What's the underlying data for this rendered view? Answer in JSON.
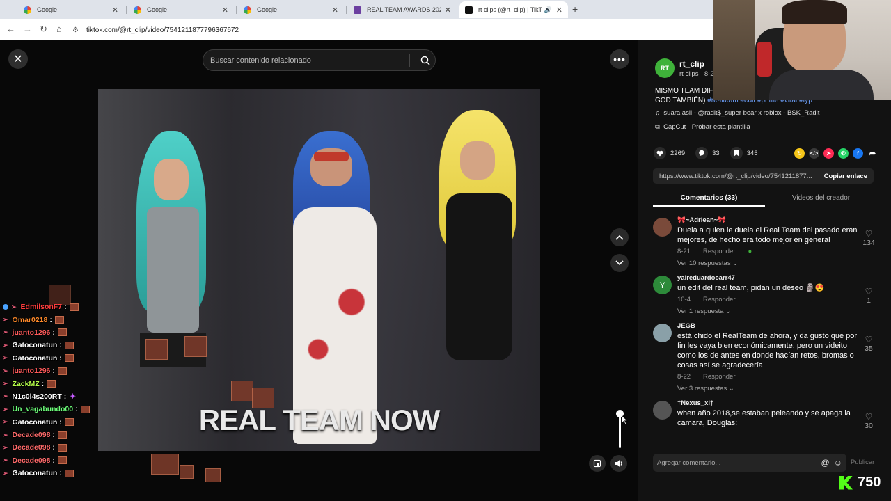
{
  "browser": {
    "tabs": [
      {
        "title": "Google",
        "icon": "google-icon",
        "active": false
      },
      {
        "title": "Google",
        "icon": "google-icon",
        "active": false
      },
      {
        "title": "Google",
        "icon": "google-icon",
        "active": false
      },
      {
        "title": "REAL TEAM AWARDS 2025🏆",
        "icon": "realteam-icon",
        "active": false
      },
      {
        "title": "rt clips (@rt_clip) | TikTok",
        "icon": "tiktok-icon",
        "active": true
      }
    ],
    "new_tab": "+",
    "url": "tiktok.com/@rt_clip/video/7541211877796367672"
  },
  "viewer": {
    "search_placeholder": "Buscar contenido relacionado",
    "video_caption": "REAL TEAM NOW"
  },
  "chat": [
    {
      "user": "EdmilsonF7",
      "color": "#ff3d3d",
      "badge": true
    },
    {
      "user": "Omar0218",
      "color": "#ff8a2a",
      "badge": false
    },
    {
      "user": "juanto1296",
      "color": "#ff5a5a",
      "badge": false
    },
    {
      "user": "Gatoconatun",
      "color": "#ffffff",
      "badge": false
    },
    {
      "user": "Gatoconatun",
      "color": "#ffffff",
      "badge": false
    },
    {
      "user": "juanto1296",
      "color": "#ff5a5a",
      "badge": false
    },
    {
      "user": "ZackMZ",
      "color": "#b6ff4a",
      "badge": false
    },
    {
      "user": "N1c0l4s200RT",
      "color": "#ffffff",
      "badge": false
    },
    {
      "user": "Un_vagabundo00",
      "color": "#6dff7a",
      "badge": false
    },
    {
      "user": "Gatoconatun",
      "color": "#ffffff",
      "badge": false
    },
    {
      "user": "Decade098",
      "color": "#ff6a6a",
      "badge": false
    },
    {
      "user": "Decade098",
      "color": "#ff6a6a",
      "badge": false
    },
    {
      "user": "Decade098",
      "color": "#ff6a6a",
      "badge": false
    },
    {
      "user": "Gatoconatun",
      "color": "#ffffff",
      "badge": false
    }
  ],
  "panel": {
    "author_name": "rt_clip",
    "author_sub": "rt clips · 8-2",
    "description": "MISMO TEAM DIF",
    "description_rest": "GOD TAMBIÉN)",
    "hashtags": "#realteam #edit #prime #viral #fyp",
    "music": "suara asli - @radit$_super bear x roblox - BSK_Radit",
    "capcut": "CapCut · Probar esta plantilla",
    "likes": "2269",
    "comments_count": "33",
    "saves": "345",
    "link": "https://www.tiktok.com/@rt_clip/video/7541211877...",
    "copy_label": "Copiar enlace",
    "tab_comments": "Comentarios (33)",
    "tab_creator": "Videos del creador",
    "comments": [
      {
        "user": "🎀~Adriean~🎀",
        "text": "Duela a quien le duela el Real Team del pasado eran mejores, de hecho era todo mejor en general",
        "date": "8-21",
        "reply": "Responder",
        "replies": "Ver 10 respuestas ⌄",
        "likes": "134",
        "avatar_color": "#7a4a3a"
      },
      {
        "user": "yaireduardocarr47",
        "text": "un edit del real team, pidan un deseo 🗿😍",
        "date": "10-4",
        "reply": "Responder",
        "replies": "Ver 1 respuesta ⌄",
        "likes": "1",
        "avatar_color": "#2d8a3a"
      },
      {
        "user": "JEGB",
        "text": "está chido el RealTeam de ahora, y da gusto que por fin les vaya bien económicamente, pero un videito como los de antes en donde hacían retos, bromas o cosas así se agradecería",
        "date": "8-22",
        "reply": "Responder",
        "replies": "Ver 3 respuestas ⌄",
        "likes": "35",
        "avatar_color": "#8aa0a8"
      },
      {
        "user": "†Nexus_xl†",
        "text": "when año 2018,se estaban peleando y se apaga la camara, Douglas:",
        "date": "",
        "reply": "",
        "replies": "",
        "likes": "30",
        "avatar_color": "#555555"
      }
    ],
    "comment_placeholder": "Agregar comentario...",
    "publish_label": "Publicar"
  },
  "overlay": {
    "kick_viewers": "750"
  }
}
